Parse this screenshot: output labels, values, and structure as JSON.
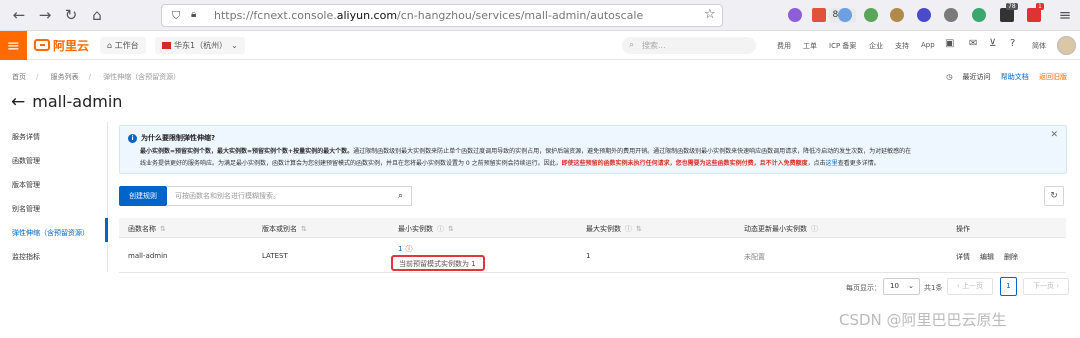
{
  "browser": {
    "url_host": "https://fcnext.console.",
    "url_domain": "aliyun.com",
    "url_path": "/cn-hangzhou/services/mall-admin/autoscale",
    "zoom": "80%",
    "tab_badges": [
      "78",
      "1"
    ]
  },
  "topnav": {
    "logo": "阿里云",
    "workbench": "工作台",
    "region": "华东1（杭州）",
    "search_placeholder": "搜索...",
    "menu": [
      "费用",
      "工单",
      "ICP 备案",
      "企业",
      "支持",
      "App"
    ],
    "language": "简体"
  },
  "breadcrumb": [
    "首页",
    "服务列表",
    "弹性伸缩（含预留资源）"
  ],
  "header_links": {
    "recent": "最近访问",
    "help": "帮助文档",
    "old": "返回旧版"
  },
  "page_title": "mall-admin",
  "sidebar": [
    "服务详情",
    "函数管理",
    "版本管理",
    "别名管理",
    "弹性伸缩（含预留资源）",
    "监控指标"
  ],
  "notice": {
    "title": "为什么要限制弹性伸缩?",
    "line1_a": "最小实例数=预留实例个数，最大实例数=预留实例个数+按量实例的最大个数。",
    "line1_b": "通过限制函数级别最大实例数来防止单个函数过度调用导致的实例占用，保护后端资源，避免预期外的费用开销。通过限制函数级别最小实例数来快速响应函数调用请求，降低冷启动的发生次数，为对延敏感的在",
    "line2_a": "线业务提供更好的服务响应。为满足最小实例数，函数计算会为您创建预留模式的函数实例，并且在您将最小实例数设置为 0 之前预留实例会持续运行。因此，",
    "line2_red": "即使这些预留的函数实例未执行任何请求，您也需要为这些函数实例付费，且不计入免费额度",
    "line2_b": "，点击",
    "line2_link": "这里",
    "line2_c": "查看更多详情。"
  },
  "toolbar": {
    "create": "创建规则",
    "search_placeholder": "可按函数名和别名进行模糊搜索。"
  },
  "table": {
    "headers": [
      "函数名称",
      "版本或别名",
      "最小实例数",
      "最大实例数",
      "动态更新最小实例数",
      "操作"
    ],
    "row": {
      "function": "mall-admin",
      "version": "LATEST",
      "min": "1",
      "min_note": "当前预留模式实例数为 1",
      "max": "1",
      "dynamic": "未配置",
      "actions": [
        "详情",
        "编辑",
        "删除"
      ]
    }
  },
  "pager": {
    "per_page_label": "每页显示：",
    "per_page": "10",
    "total": "共1条",
    "prev": "上一页",
    "current": "1",
    "next": "下一页"
  },
  "watermark": "CSDN @阿里巴巴云原生",
  "colors": {
    "accent": "#0064c8",
    "brand": "#ff6a00",
    "alert": "#d93026"
  }
}
